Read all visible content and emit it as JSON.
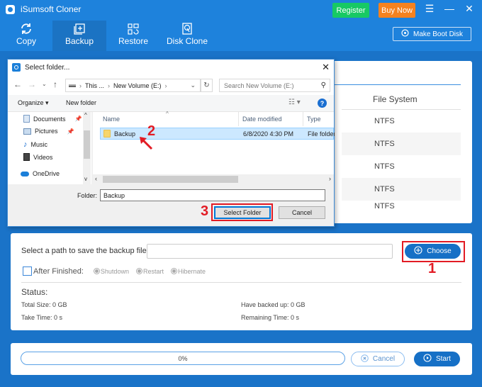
{
  "app": {
    "title": "iSumsoft Cloner",
    "register_label": "Register",
    "buynow_label": "Buy Now",
    "boot_disk_label": "Make Boot Disk",
    "nav": [
      {
        "label": "Copy",
        "icon": "sync-icon",
        "active": false
      },
      {
        "label": "Backup",
        "icon": "backup-plus-icon",
        "active": true
      },
      {
        "label": "Restore",
        "icon": "restore-icon",
        "active": false
      },
      {
        "label": "Disk Clone",
        "icon": "disk-clone-icon",
        "active": false
      }
    ],
    "colors": {
      "primary": "#1e82dc",
      "register": "#17c964",
      "buynow": "#f5821f",
      "button": "#1670c6",
      "annotation": "#e21b24"
    }
  },
  "disk_table": {
    "file_system_header": "File System",
    "rows": [
      "NTFS",
      "NTFS",
      "NTFS",
      "NTFS",
      "NTFS"
    ]
  },
  "backup_path": {
    "label": "Select a path to save the backup file:",
    "value": "",
    "choose_label": "Choose",
    "after_finished_label": "After Finished:",
    "after_finished_checked": false,
    "options": [
      "Shutdown",
      "Restart",
      "Hibernate"
    ]
  },
  "status": {
    "title": "Status:",
    "total_size": "Total Size: 0 GB",
    "have_backed_up": "Have backed up: 0 GB",
    "take_time": "Take Time: 0 s",
    "remaining_time": "Remaining Time: 0 s"
  },
  "progress": {
    "value": 0,
    "text": "0%",
    "cancel_label": "Cancel",
    "start_label": "Start"
  },
  "dialog": {
    "title": "Select folder...",
    "breadcrumb": [
      "This ...",
      "New Volume (E:)"
    ],
    "search_placeholder": "Search New Volume (E:)",
    "organize_label": "Organize ▾",
    "new_folder_label": "New folder",
    "nav_pane": [
      {
        "label": "Documents",
        "pinned": true
      },
      {
        "label": "Pictures",
        "pinned": true
      },
      {
        "label": "Music",
        "pinned": false
      },
      {
        "label": "Videos",
        "pinned": false
      },
      {
        "label": "OneDrive",
        "pinned": false
      }
    ],
    "columns": {
      "name": "Name",
      "date": "Date modified",
      "type": "Type"
    },
    "files": [
      {
        "name": "Backup",
        "date": "6/8/2020 4:30 PM",
        "type": "File folder",
        "selected": true
      }
    ],
    "folder_label": "Folder:",
    "folder_value": "Backup",
    "select_label": "Select Folder",
    "cancel_label": "Cancel"
  },
  "annotations": [
    "1",
    "2",
    "3"
  ]
}
